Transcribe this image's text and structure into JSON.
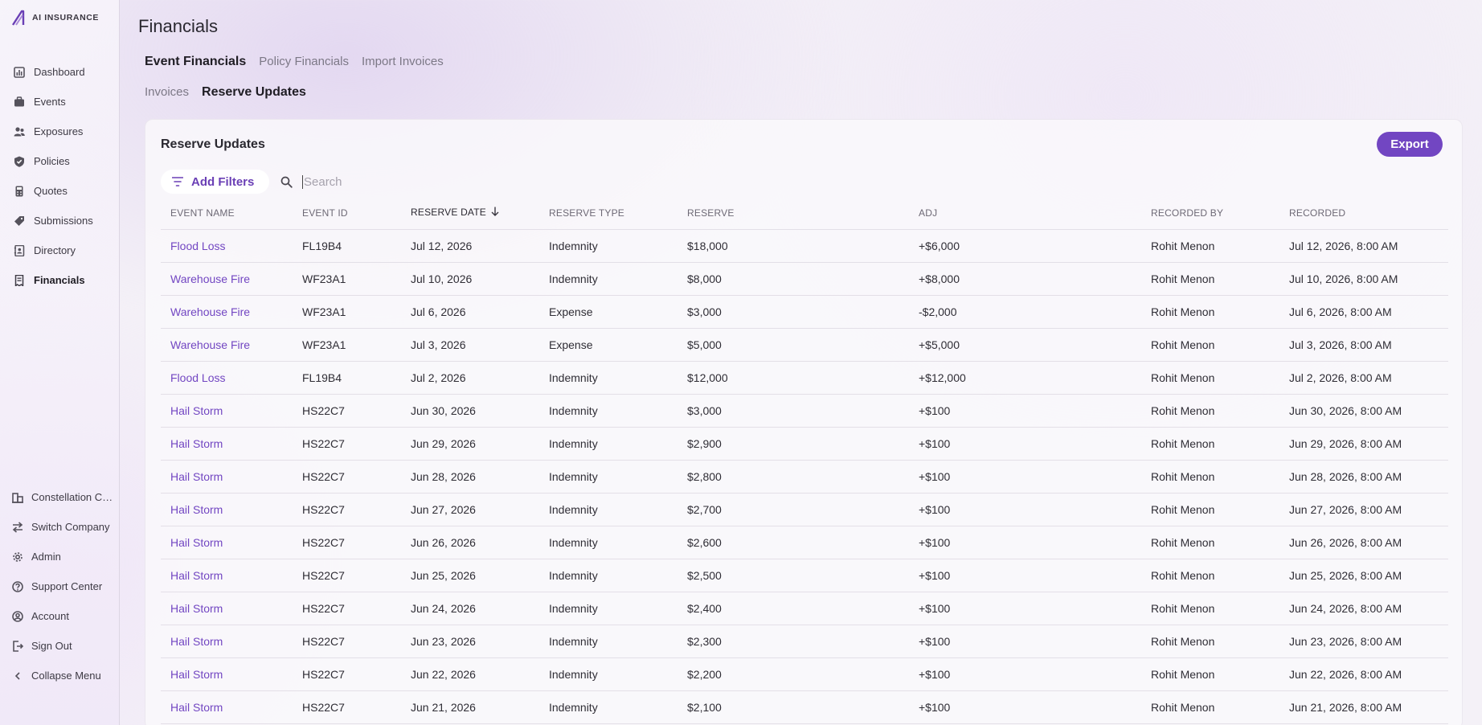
{
  "brand": {
    "name": "AI INSURANCE",
    "accent": "#7246c2"
  },
  "nav": [
    {
      "label": "Dashboard",
      "icon": "chart-icon",
      "active": false
    },
    {
      "label": "Events",
      "icon": "briefcase-icon",
      "active": false
    },
    {
      "label": "Exposures",
      "icon": "people-icon",
      "active": false
    },
    {
      "label": "Policies",
      "icon": "shield-icon",
      "active": false
    },
    {
      "label": "Quotes",
      "icon": "calculator-icon",
      "active": false
    },
    {
      "label": "Submissions",
      "icon": "tag-icon",
      "active": false
    },
    {
      "label": "Directory",
      "icon": "contacts-icon",
      "active": false
    },
    {
      "label": "Financials",
      "icon": "receipt-icon",
      "active": true
    }
  ],
  "bottom_nav": [
    {
      "label": "Constellation Company",
      "icon": "building-icon"
    },
    {
      "label": "Switch Company",
      "icon": "switch-icon"
    },
    {
      "label": "Admin",
      "icon": "gear-icon"
    },
    {
      "label": "Support Center",
      "icon": "help-icon"
    },
    {
      "label": "Account",
      "icon": "account-icon"
    },
    {
      "label": "Sign Out",
      "icon": "sign-out-icon"
    },
    {
      "label": "Collapse Menu",
      "icon": "chevron-left-icon"
    }
  ],
  "page": {
    "title": "Financials"
  },
  "tabs_primary": [
    {
      "label": "Event Financials",
      "active": true
    },
    {
      "label": "Policy Financials",
      "active": false
    },
    {
      "label": "Import Invoices",
      "active": false
    }
  ],
  "tabs_secondary": [
    {
      "label": "Invoices",
      "active": false
    },
    {
      "label": "Reserve Updates",
      "active": true
    }
  ],
  "card": {
    "title": "Reserve Updates",
    "export_label": "Export",
    "filter_label": "Add Filters",
    "search_placeholder": "Search"
  },
  "table": {
    "columns": [
      "EVENT NAME",
      "EVENT ID",
      "RESERVE DATE",
      "RESERVE TYPE",
      "RESERVE",
      "ADJ",
      "RECORDED BY",
      "RECORDED"
    ],
    "sorted_column": "RESERVE DATE",
    "rows": [
      [
        "Flood Loss",
        "FL19B4",
        "Jul 12, 2026",
        "Indemnity",
        "$18,000",
        "+$6,000",
        "Rohit Menon",
        "Jul 12, 2026, 8:00 AM"
      ],
      [
        "Warehouse Fire",
        "WF23A1",
        "Jul 10, 2026",
        "Indemnity",
        "$8,000",
        "+$8,000",
        "Rohit Menon",
        "Jul 10, 2026, 8:00 AM"
      ],
      [
        "Warehouse Fire",
        "WF23A1",
        "Jul 6, 2026",
        "Expense",
        "$3,000",
        "-$2,000",
        "Rohit Menon",
        "Jul 6, 2026, 8:00 AM"
      ],
      [
        "Warehouse Fire",
        "WF23A1",
        "Jul 3, 2026",
        "Expense",
        "$5,000",
        "+$5,000",
        "Rohit Menon",
        "Jul 3, 2026, 8:00 AM"
      ],
      [
        "Flood Loss",
        "FL19B4",
        "Jul 2, 2026",
        "Indemnity",
        "$12,000",
        "+$12,000",
        "Rohit Menon",
        "Jul 2, 2026, 8:00 AM"
      ],
      [
        "Hail Storm",
        "HS22C7",
        "Jun 30, 2026",
        "Indemnity",
        "$3,000",
        "+$100",
        "Rohit Menon",
        "Jun 30, 2026, 8:00 AM"
      ],
      [
        "Hail Storm",
        "HS22C7",
        "Jun 29, 2026",
        "Indemnity",
        "$2,900",
        "+$100",
        "Rohit Menon",
        "Jun 29, 2026, 8:00 AM"
      ],
      [
        "Hail Storm",
        "HS22C7",
        "Jun 28, 2026",
        "Indemnity",
        "$2,800",
        "+$100",
        "Rohit Menon",
        "Jun 28, 2026, 8:00 AM"
      ],
      [
        "Hail Storm",
        "HS22C7",
        "Jun 27, 2026",
        "Indemnity",
        "$2,700",
        "+$100",
        "Rohit Menon",
        "Jun 27, 2026, 8:00 AM"
      ],
      [
        "Hail Storm",
        "HS22C7",
        "Jun 26, 2026",
        "Indemnity",
        "$2,600",
        "+$100",
        "Rohit Menon",
        "Jun 26, 2026, 8:00 AM"
      ],
      [
        "Hail Storm",
        "HS22C7",
        "Jun 25, 2026",
        "Indemnity",
        "$2,500",
        "+$100",
        "Rohit Menon",
        "Jun 25, 2026, 8:00 AM"
      ],
      [
        "Hail Storm",
        "HS22C7",
        "Jun 24, 2026",
        "Indemnity",
        "$2,400",
        "+$100",
        "Rohit Menon",
        "Jun 24, 2026, 8:00 AM"
      ],
      [
        "Hail Storm",
        "HS22C7",
        "Jun 23, 2026",
        "Indemnity",
        "$2,300",
        "+$100",
        "Rohit Menon",
        "Jun 23, 2026, 8:00 AM"
      ],
      [
        "Hail Storm",
        "HS22C7",
        "Jun 22, 2026",
        "Indemnity",
        "$2,200",
        "+$100",
        "Rohit Menon",
        "Jun 22, 2026, 8:00 AM"
      ],
      [
        "Hail Storm",
        "HS22C7",
        "Jun 21, 2026",
        "Indemnity",
        "$2,100",
        "+$100",
        "Rohit Menon",
        "Jun 21, 2026, 8:00 AM"
      ]
    ]
  }
}
